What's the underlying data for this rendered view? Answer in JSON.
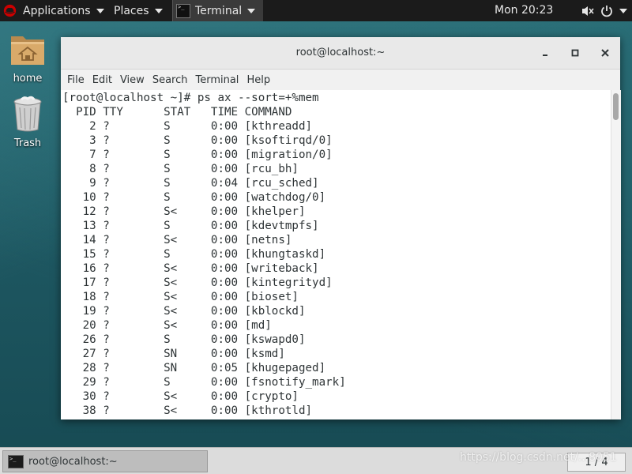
{
  "topbar": {
    "applications_label": "Applications",
    "places_label": "Places",
    "terminal_label": "Terminal",
    "clock": "Mon 20:23"
  },
  "desktop": {
    "home_label": "home",
    "trash_label": "Trash"
  },
  "window": {
    "title": "root@localhost:~",
    "menu": [
      "File",
      "Edit",
      "View",
      "Search",
      "Terminal",
      "Help"
    ]
  },
  "terminal": {
    "prompt": "[root@localhost ~]# ps ax --sort=+%mem",
    "header": "  PID TTY      STAT   TIME COMMAND",
    "rows": [
      {
        "pid": "2",
        "tty": "?",
        "stat": "S",
        "time": "0:00",
        "command": "[kthreadd]"
      },
      {
        "pid": "3",
        "tty": "?",
        "stat": "S",
        "time": "0:00",
        "command": "[ksoftirqd/0]"
      },
      {
        "pid": "7",
        "tty": "?",
        "stat": "S",
        "time": "0:00",
        "command": "[migration/0]"
      },
      {
        "pid": "8",
        "tty": "?",
        "stat": "S",
        "time": "0:00",
        "command": "[rcu_bh]"
      },
      {
        "pid": "9",
        "tty": "?",
        "stat": "S",
        "time": "0:04",
        "command": "[rcu_sched]"
      },
      {
        "pid": "10",
        "tty": "?",
        "stat": "S",
        "time": "0:00",
        "command": "[watchdog/0]"
      },
      {
        "pid": "12",
        "tty": "?",
        "stat": "S<",
        "time": "0:00",
        "command": "[khelper]"
      },
      {
        "pid": "13",
        "tty": "?",
        "stat": "S",
        "time": "0:00",
        "command": "[kdevtmpfs]"
      },
      {
        "pid": "14",
        "tty": "?",
        "stat": "S<",
        "time": "0:00",
        "command": "[netns]"
      },
      {
        "pid": "15",
        "tty": "?",
        "stat": "S",
        "time": "0:00",
        "command": "[khungtaskd]"
      },
      {
        "pid": "16",
        "tty": "?",
        "stat": "S<",
        "time": "0:00",
        "command": "[writeback]"
      },
      {
        "pid": "17",
        "tty": "?",
        "stat": "S<",
        "time": "0:00",
        "command": "[kintegrityd]"
      },
      {
        "pid": "18",
        "tty": "?",
        "stat": "S<",
        "time": "0:00",
        "command": "[bioset]"
      },
      {
        "pid": "19",
        "tty": "?",
        "stat": "S<",
        "time": "0:00",
        "command": "[kblockd]"
      },
      {
        "pid": "20",
        "tty": "?",
        "stat": "S<",
        "time": "0:00",
        "command": "[md]"
      },
      {
        "pid": "26",
        "tty": "?",
        "stat": "S",
        "time": "0:00",
        "command": "[kswapd0]"
      },
      {
        "pid": "27",
        "tty": "?",
        "stat": "SN",
        "time": "0:00",
        "command": "[ksmd]"
      },
      {
        "pid": "28",
        "tty": "?",
        "stat": "SN",
        "time": "0:05",
        "command": "[khugepaged]"
      },
      {
        "pid": "29",
        "tty": "?",
        "stat": "S",
        "time": "0:00",
        "command": "[fsnotify_mark]"
      },
      {
        "pid": "30",
        "tty": "?",
        "stat": "S<",
        "time": "0:00",
        "command": "[crypto]"
      },
      {
        "pid": "38",
        "tty": "?",
        "stat": "S<",
        "time": "0:00",
        "command": "[kthrotld]"
      }
    ]
  },
  "taskbar": {
    "task_label": "root@localhost:~",
    "pager": "1 / 4",
    "watermark": "https://blog.csdn.net/...8051"
  },
  "colors": {
    "topbar_bg": "#1b1b1b",
    "desktop_bg": "#1f5a63",
    "terminal_fg": "#2e3436",
    "terminal_bg": "#ffffff",
    "redhat_red": "#cc0000"
  },
  "icons": {
    "apps": "redhat-icon",
    "terminal_app": "terminal-icon",
    "volume": "volume-muted-icon",
    "power": "power-icon",
    "home": "home-folder-icon",
    "trash": "trash-icon"
  }
}
